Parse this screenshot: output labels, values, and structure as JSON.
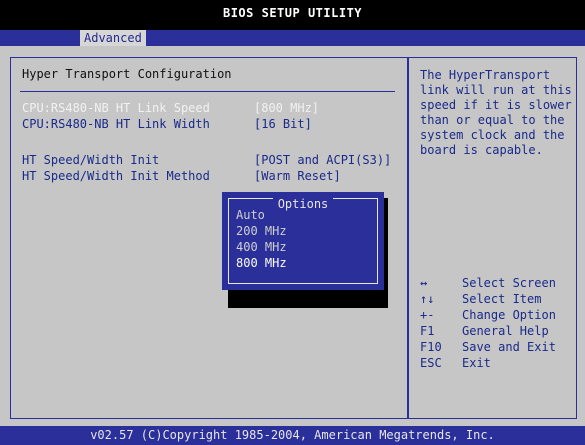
{
  "window": {
    "title": "BIOS SETUP UTILITY"
  },
  "tabs": [
    {
      "label": "Advanced",
      "active": true
    }
  ],
  "section": {
    "title": "Hyper Transport Configuration"
  },
  "settings": [
    {
      "label": "CPU:RS480-NB HT Link Speed",
      "value": "[800 MHz]"
    },
    {
      "label": "CPU:RS480-NB HT Link Width",
      "value": "[16 Bit]"
    },
    {
      "label": "HT Speed/Width Init",
      "value": "[POST and ACPI(S3)]"
    },
    {
      "label": "HT Speed/Width Init Method",
      "value": "[Warm Reset]"
    }
  ],
  "popup": {
    "title": "Options",
    "options": [
      "Auto",
      "200 MHz",
      "400 MHz",
      "800 MHz"
    ],
    "selected": "800 MHz"
  },
  "help": {
    "lines": [
      "The HyperTransport",
      "link will run at this",
      "speed if it is slower",
      "than or equal to the",
      "system clock and the",
      "board is capable."
    ]
  },
  "keys": [
    {
      "key": "↔",
      "desc": "Select Screen"
    },
    {
      "key": "↑↓",
      "desc": "Select Item"
    },
    {
      "key": "+-",
      "desc": "Change Option"
    },
    {
      "key": "F1",
      "desc": "General Help"
    },
    {
      "key": "F10",
      "desc": "Save and Exit"
    },
    {
      "key": "ESC",
      "desc": "Exit"
    }
  ],
  "footer": {
    "text": "v02.57 (C)Copyright 1985-2004, American Megatrends, Inc."
  },
  "colors": {
    "bios_blue": "#2a2f9a",
    "panel_gray": "#c6c6c6",
    "highlight_text": "#ffffff",
    "help_text": "#1a2a8a"
  }
}
